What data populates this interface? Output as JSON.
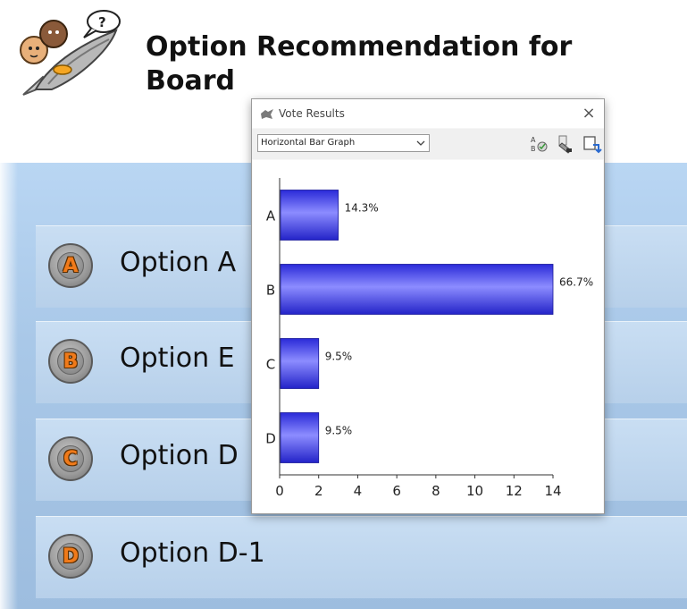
{
  "slide": {
    "title_line1": "Option Recommendation for",
    "title_line2": "Board",
    "options": [
      {
        "letter": "A",
        "label": "Option A"
      },
      {
        "letter": "B",
        "label": "Option E"
      },
      {
        "letter": "C",
        "label": "Option D"
      },
      {
        "letter": "D",
        "label": "Option D-1"
      }
    ]
  },
  "dialog": {
    "title": "Vote Results",
    "close_label": "×",
    "chart_type_value": "Horizontal Bar Graph",
    "toolbar_icons": [
      "label-toggle-icon",
      "eraser-icon",
      "export-icon"
    ],
    "bar_color": "#3a3aef"
  },
  "chart_data": {
    "type": "bar",
    "orientation": "horizontal",
    "categories": [
      "A",
      "B",
      "C",
      "D"
    ],
    "values": [
      3,
      14,
      2,
      2
    ],
    "data_labels": [
      "14.3%",
      "66.7%",
      "9.5%",
      "9.5%"
    ],
    "xlim": [
      0,
      14
    ],
    "xticks": [
      "0",
      "2",
      "4",
      "6",
      "8",
      "10",
      "12",
      "14"
    ],
    "grid": false,
    "legend": "none"
  }
}
